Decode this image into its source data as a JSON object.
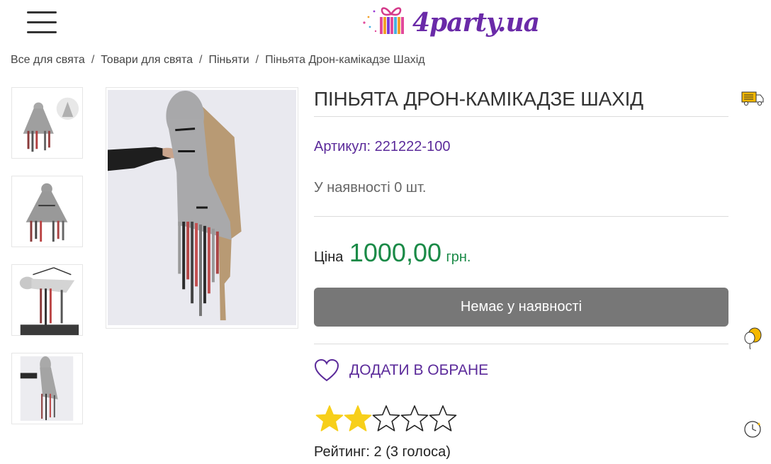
{
  "header": {
    "logo_text": "4party.ua",
    "brand_color": "#6a2aa8"
  },
  "breadcrumb": {
    "items": [
      "Все для свята",
      "Товари для свята",
      "Піньяти",
      "Піньята Дрон-камікадзе Шахід"
    ],
    "separator": "/"
  },
  "gallery": {
    "thumbnails": [
      "thumb-1",
      "thumb-2",
      "thumb-3",
      "thumb-4"
    ]
  },
  "product": {
    "title": "ПІНЬЯТА ДРОН-КАМІКАДЗЕ ШАХІД",
    "sku": "Артикул: 221222-100",
    "stock": "У наявності 0 шт.",
    "price_label": "Ціна",
    "price_value": "1000,00",
    "price_currency": "грн.",
    "price_color": "#1a8a47",
    "unavailable_label": "Немає у наявності",
    "favorite_label": "ДОДАТИ В ОБРАНЕ",
    "rating_filled": 2,
    "rating_max": 5,
    "rating_text": "Рейтинг: 2 (3 голоса)"
  },
  "side_icons": [
    "delivery-truck-icon",
    "balloon-icon",
    "clock-icon"
  ]
}
